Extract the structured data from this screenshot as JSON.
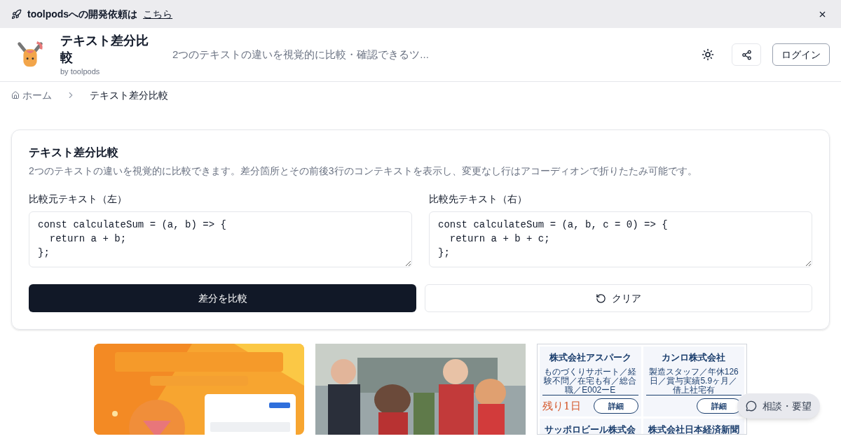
{
  "banner": {
    "text": "toolpodsへの開発依頼は",
    "link": "こちら"
  },
  "header": {
    "title": "テキスト差分比較",
    "byline": "by toolpods",
    "tagline": "2つのテキストの違いを視覚的に比較・確認できるツ...",
    "login": "ログイン"
  },
  "breadcrumb": [
    {
      "label": "ホーム",
      "kind": "home"
    },
    {
      "label": "テキスト差分比較",
      "kind": "current"
    }
  ],
  "card": {
    "title": "テキスト差分比較",
    "description": "2つのテキストの違いを視覚的に比較できます。差分箇所とその前後3行のコンテキストを表示し、変更なし行はアコーディオンで折りたたみ可能です。",
    "fields": [
      {
        "label": "比較元テキスト（左）",
        "value": "const calculateSum = (a, b) => {\n  return a + b;\n};"
      },
      {
        "label": "比較先テキスト（右）",
        "value": "const calculateSum = (a, b, c = 0) => {\n  return a + b + c;\n};"
      }
    ],
    "compare_button": "差分を比較",
    "clear_button": "クリア"
  },
  "ads": [
    {
      "kind": "picture"
    },
    {
      "kind": "picture"
    },
    {
      "kind": "listing",
      "items": [
        {
          "company": "株式会社アスパーク",
          "detail": "ものづくりサポート／経験不問／在宅も有／総合職／E002ーE",
          "badge": "残り1日",
          "button": "詳細"
        },
        {
          "company": "カンロ株式会社",
          "detail": "製造スタッフ／年休126日／賞与実績5.9ヶ月／借上社宅有",
          "button": "詳細"
        },
        {
          "company": "サッポロビール株式会"
        },
        {
          "company": "株式会社日本経済新聞"
        }
      ]
    }
  ],
  "chat_button": "相談・要望"
}
